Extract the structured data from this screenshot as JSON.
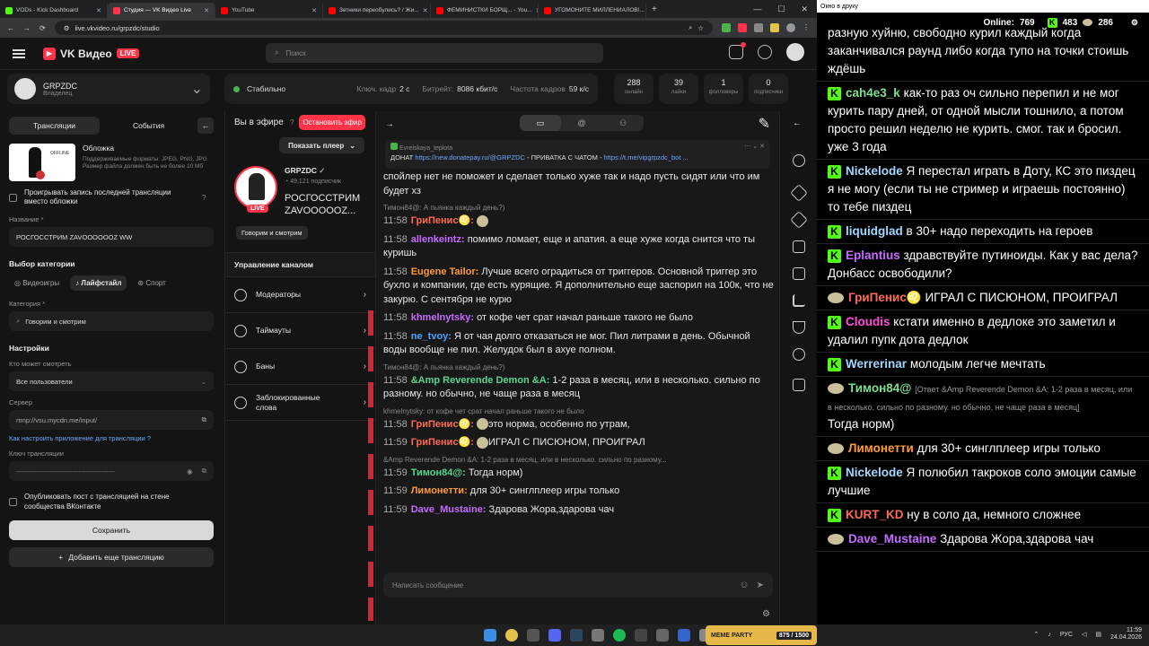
{
  "tabs": [
    {
      "label": "VODs - Kick Dashboard",
      "color": "#53fc18"
    },
    {
      "label": "Студия — VK Видео Live",
      "color": "#ff3347"
    },
    {
      "label": "YouTube",
      "color": "#ff0000"
    },
    {
      "label": "Зетники переобулись? / Жи...",
      "color": "#ff0000"
    },
    {
      "label": "ФЕМИНИСТКИ БОРЩ... - You...",
      "color": "#ff0000"
    },
    {
      "label": "УГОМОНИТЕ МИЛЛЕНИАЛОВ!...",
      "color": "#ff0000"
    }
  ],
  "url": "live.vkvideo.ru/grpzdc/studio",
  "brand": {
    "name": "VK Видео",
    "badge": "LIVE"
  },
  "search_placeholder": "Поиск",
  "channel": {
    "name": "GRPZDC",
    "role": "Владелец",
    "status": "Стабильно",
    "keyframe_label": "Ключ. кадр",
    "keyframe": "2 с",
    "bitrate_label": "Битрейт:",
    "bitrate": "8086 кбит/с",
    "fps_label": "Частота кадров",
    "fps": "59 к/с"
  },
  "counters": [
    {
      "v": "288",
      "l": "онлайн"
    },
    {
      "v": "39",
      "l": "лайки"
    },
    {
      "v": "1",
      "l": "фолловеры"
    },
    {
      "v": "0",
      "l": "подписчики"
    }
  ],
  "left": {
    "tab1": "Трансляции",
    "tab2": "События",
    "cover_title": "Обложка",
    "cover_hint": "Поддерживаемые форматы: JPEG, PNG, JPG Размер файла должен быть не более 10 Мб",
    "cover_thumb": "OFFLINE",
    "loop_label": "Проигрывать запись последней трансляции вместо обложки",
    "name_label": "Название *",
    "name_value": "РОСГОССТРИМ ZAVOOOOOOZ WW",
    "cat_sec": "Выбор категории",
    "cat_games": "Видеоигры",
    "cat_life": "Лайфстайл",
    "cat_sport": "Спорт",
    "category_label": "Категория *",
    "category_value": "Говорим и смотрим",
    "settings": "Настройки",
    "who_label": "Кто может смотреть",
    "who_value": "Все пользователи",
    "server_label": "Сервер",
    "server_value": "rtmp://vsu.mycdn.me/input/",
    "howto": "Как настроить приложение для трансляции",
    "key_label": "Ключ трансляции",
    "key_value": "--------------------------------------------",
    "publish_label": "Опубликовать пост с трансляцией на стене сообщества ВКонтакте",
    "save": "Сохранить",
    "add": "Добавить еще трансляцию"
  },
  "mid": {
    "onair": "Вы в эфире",
    "stop": "Остановить эфир",
    "show_player": "Показать плеер",
    "ch_name": "GRPZDC",
    "subs": "49,121 подписчик",
    "title": "РОСГОССТРИМ ZAVOOOOOZ...",
    "live_badge": "LIVE",
    "tag": "Говорим и смотрим",
    "manage": "Управление каналом",
    "items": [
      "Модераторы",
      "Таймауты",
      "Баны",
      "Заблокированные слова"
    ]
  },
  "pinned": {
    "author": "Evreiskaya_teplota",
    "prefix": "ДОНАТ",
    "link1": "https://new.donatepay.ru/@GRPZDC",
    "mid": "- ПРИВАТКА С ЧАТОМ -",
    "link2": "https://t.me/vipgrpzdc_bot ..."
  },
  "chat": [
    {
      "time": "",
      "user": "",
      "color": "#ddd",
      "text": "спойлер нет не поможет и сделает только хуже так и надо пусть сидят или что им будет хз",
      "reply": ""
    },
    {
      "time": "11:58",
      "user": "ГриПенис♌:",
      "color": "#ff6a55",
      "text": "",
      "reply": "Тимон84@: А пьянка каждый день?)"
    },
    {
      "time": "11:58",
      "user": "allenkeintz:",
      "color": "#c56bff",
      "text": "помимо ломает, еще и апатия. а еще хуже когда снится что ты куришь",
      "reply": ""
    },
    {
      "time": "11:58",
      "user": "Eugene Tailor:",
      "color": "#ff9a3c",
      "text": "Лучше всего оградиться от триггеров. Основной триггер это бухло и компании, где есть курящие. Я дополнительно еще заспорил на 100к, что не закурю. С сентября не курю",
      "reply": ""
    },
    {
      "time": "11:58",
      "user": "khmelnytsky:",
      "color": "#c56bff",
      "text": "от кофе чет срат начал раньше такого не было",
      "reply": ""
    },
    {
      "time": "11:58",
      "user": "ne_tvoy:",
      "color": "#4aa3ff",
      "text": "Я от чая долго отказаться не мог. Пил литрами в день. Обычной воды вообще не пил. Желудок был в ахуе полном.",
      "reply": ""
    },
    {
      "time": "11:58",
      "user": "&Amp Reverende Demon &A:",
      "color": "#58d68d",
      "text": "1-2 раза в месяц, или в несколько. сильно по разному. но обычно, не чаще раза в месяц",
      "reply": "Тимон84@: А пьянка каждый день?)"
    },
    {
      "time": "11:58",
      "user": "ГриПенис♌:",
      "color": "#ff6a55",
      "text": "это норма, особенно по утрам,",
      "reply": "khmelnytsky: от кофе чет срат начал раньше такого не было"
    },
    {
      "time": "11:59",
      "user": "ГриПенис♌:",
      "color": "#ff6a55",
      "text": "ИГРАЛ С ПИСЮНОМ, ПРОИГРАЛ",
      "reply": ""
    },
    {
      "time": "11:59",
      "user": "Тимон84@:",
      "color": "#58d68d",
      "text": "Тогда норм)",
      "reply": "&Amp Reverende Demon &A: 1-2 раза в месяц, или в несколько. сильно по разному..."
    },
    {
      "time": "11:59",
      "user": "Лимонетти:",
      "color": "#ff9a3c",
      "text": "для 30+ синглплеер игры только",
      "reply": ""
    },
    {
      "time": "11:59",
      "user": "Dave_Mustaine:",
      "color": "#c56bff",
      "text": "Здарова Жора,здарова чач",
      "reply": ""
    }
  ],
  "chat_input_placeholder": "Написать сообщение",
  "popout": {
    "title": "Окно в друку",
    "online_label": "Online:",
    "online": "769",
    "kick_count": "483",
    "emote_count": "286"
  },
  "kick": [
    {
      "user": "",
      "color": "#fff",
      "text": "разную хуйню, свободно курил каждый когда заканчивался раунд либо когда тупо на точки стоишь ждёшь",
      "reply": "",
      "badge": "none"
    },
    {
      "user": "cah4e3_k",
      "color": "#7ee08f",
      "text": "как-то раз оч сильно перепил и не мог курить пару дней, от одной мысли тошнило, а потом просто решил неделю не курить. смог. так и бросил. уже 3 года",
      "reply": "",
      "badge": "kick"
    },
    {
      "user": "Nickelode",
      "color": "#9fd7ff",
      "text": "Я перестал играть в Доту, КС это пиздец я не могу (если ты не стример и играешь постоянно) то тебе пиздец",
      "reply": "",
      "badge": "kick"
    },
    {
      "user": "liquidglad",
      "color": "#9fd7ff",
      "text": "в 30+ надо переходить на героев",
      "reply": "",
      "badge": "kick"
    },
    {
      "user": "Eplantius",
      "color": "#c56bff",
      "text": "здравствуйте путиноиды. Как у вас дела? Донбасс освободили?",
      "reply": "",
      "badge": "kick"
    },
    {
      "user": "ГриПенис♌",
      "color": "#ff6a55",
      "text": "ИГРАЛ С ПИСЮНОМ, ПРОИГРАЛ",
      "reply": "",
      "badge": "emote"
    },
    {
      "user": "Cloudis",
      "color": "#ff4fd8",
      "text": "кстати именно в дедлоке это заметил и удалил пупк дота дедлок",
      "reply": "",
      "badge": "kick"
    },
    {
      "user": "Werrerinar",
      "color": "#9fd7ff",
      "text": "молодым легче мечтать",
      "reply": "",
      "badge": "kick"
    },
    {
      "user": "Тимон84@",
      "color": "#7ee08f",
      "text": "Тогда норм)",
      "reply": "[Ответ &Amp Reverende Demon &A: 1-2 раза в месяц, или в несколько. сильно по разному. но обычно, не чаще раза в месяц]",
      "badge": "emote"
    },
    {
      "user": "Лимонетти",
      "color": "#ff9a3c",
      "text": "для 30+ синглплеер игры только",
      "reply": "",
      "badge": "emote"
    },
    {
      "user": "Nickelode",
      "color": "#9fd7ff",
      "text": "Я полюбил такроков соло эмоции самые лучшие",
      "reply": "",
      "badge": "kick"
    },
    {
      "user": "KURT_KD",
      "color": "#ff6a55",
      "text": "ну в соло да, немного сложнее",
      "reply": "",
      "badge": "kick"
    },
    {
      "user": "Dave_Mustaine",
      "color": "#c56bff",
      "text": "Здарова Жора,здарова чач",
      "reply": "",
      "badge": "emote"
    }
  ],
  "taskbar": {
    "lang": "РУС",
    "time": "11:59",
    "date": "24.04.2026",
    "widget": "MEME PARTY",
    "widget_score": "875 / 1500"
  }
}
